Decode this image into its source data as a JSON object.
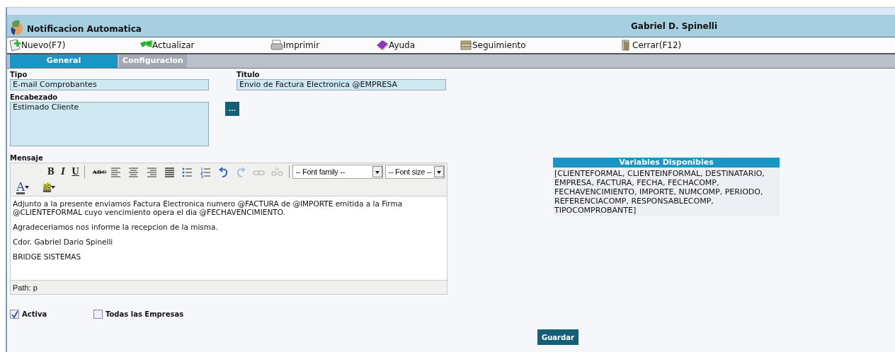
{
  "window": {
    "title": "Notificacion Automatica",
    "user": "Gabriel D. Spinelli"
  },
  "toolbar": [
    {
      "label": "Nuevo(F7)"
    },
    {
      "label": "Actualizar"
    },
    {
      "label": "Imprimir"
    },
    {
      "label": "Ayuda"
    },
    {
      "label": "Seguimiento"
    },
    {
      "label": "Cerrar(F12)"
    }
  ],
  "tabs": [
    {
      "label": "General",
      "selected": true
    },
    {
      "label": "Configuracion",
      "selected": false
    }
  ],
  "form": {
    "tipo": {
      "label": "Tipo",
      "value": "E-mail Comprobantes"
    },
    "titulo": {
      "label": "Titulo",
      "value": "Envio de Factura Electronica @EMPRESA"
    },
    "encabezado": {
      "label": "Encabezado",
      "value": "Estimado Cliente",
      "button": "..."
    },
    "mensaje": {
      "label": "Mensaje",
      "editor_toolbar": [
        {
          "kind": "text",
          "label": "B",
          "disabled": false
        },
        {
          "kind": "text",
          "label": "I",
          "disabled": false
        },
        {
          "kind": "text",
          "label": "U",
          "disabled": false
        },
        {
          "kind": "separator"
        },
        {
          "kind": "text",
          "label": "ABC",
          "disabled": false
        },
        {
          "kind": "icon",
          "disabled": false
        },
        {
          "kind": "icon",
          "disabled": false
        },
        {
          "kind": "icon",
          "disabled": false
        },
        {
          "kind": "icon",
          "disabled": false
        },
        {
          "kind": "icon",
          "disabled": false
        },
        {
          "kind": "icon",
          "disabled": false
        },
        {
          "kind": "icon",
          "disabled": false
        },
        {
          "kind": "icon",
          "disabled": true
        },
        {
          "kind": "icon",
          "disabled": true
        },
        {
          "kind": "icon",
          "disabled": true
        },
        {
          "kind": "separator"
        },
        {
          "kind": "select",
          "label": "-- Font family --"
        },
        {
          "kind": "select",
          "label": "-- Font size --"
        }
      ],
      "color_tools": [
        {
          "label": "A"
        },
        {
          "label": "ab"
        }
      ],
      "paragraphs": [
        "Adjunto a la presente enviamos Factura Electronica numero @FACTURA de @IMPORTE emitida a la Firma @CLIENTEFORMAL cuyo vencimiento opera el dia @FECHAVENCIMIENTO.",
        "Agradeceriamos nos informe la recepcion de la misma.",
        "Cdor. Gabriel Dario Spinelli",
        "BRIDGE SISTEMAS"
      ],
      "path": "Path: p"
    },
    "checkboxes": [
      {
        "label": "Activa",
        "checked": true
      },
      {
        "label": "Todas las Empresas",
        "checked": false
      }
    ],
    "save_button": "Guardar"
  },
  "variables": {
    "title": "Variables Disponibles",
    "text": "[CLIENTEFORMAL, CLIENTEINFORMAL, DESTINATARIO, EMPRESA, FACTURA, FECHA, FECHACOMP, FECHAVENCIMIENTO, IMPORTE, NUMCOMP, PERIODO, REFERENCIACOMP, RESPONSABLECOMP, TIPOCOMPROBANTE]"
  }
}
